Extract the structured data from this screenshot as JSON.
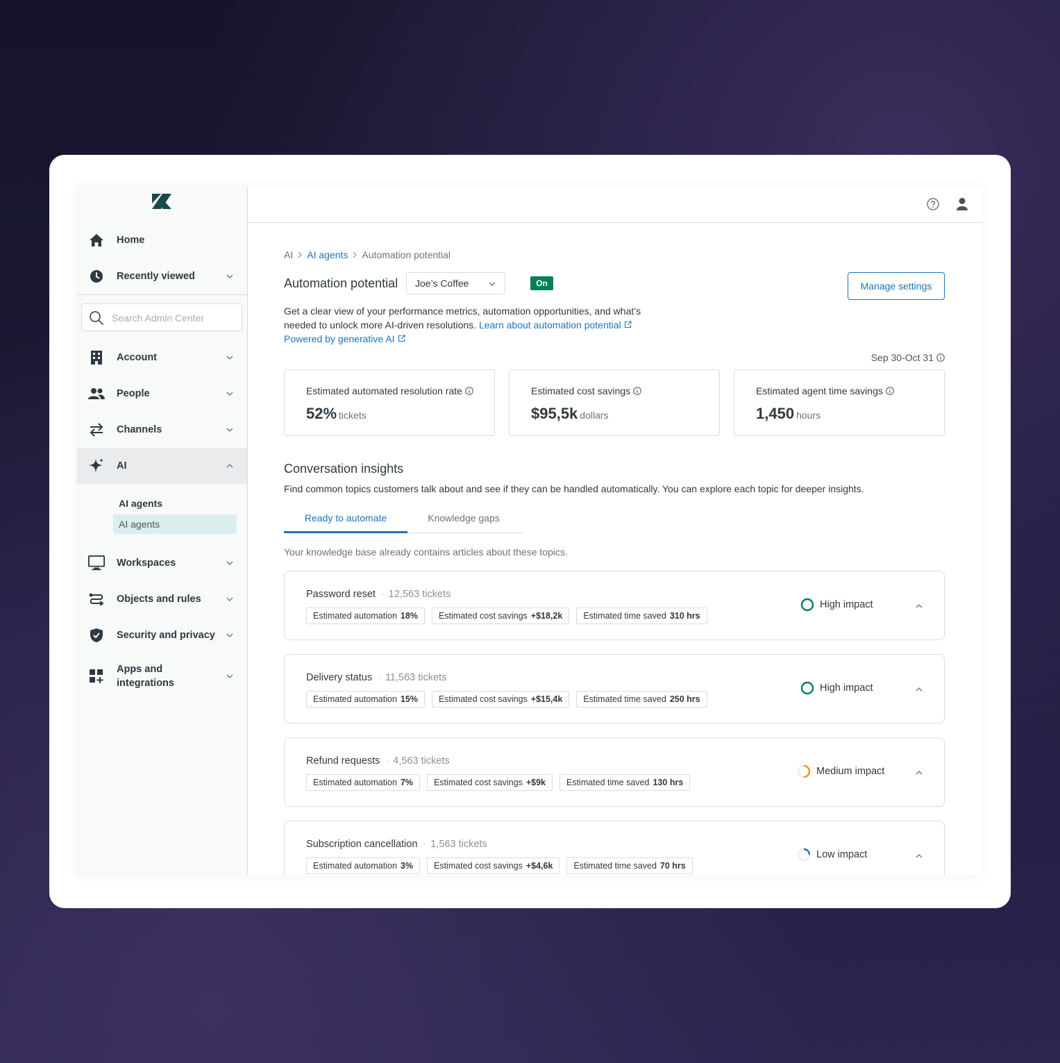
{
  "sidebar": {
    "logo": "zendesk-logo",
    "items": [
      {
        "label": "Home",
        "icon": "home-icon"
      },
      {
        "label": "Recently viewed",
        "icon": "clock-icon"
      },
      {
        "label": "Account",
        "icon": "building-icon"
      },
      {
        "label": "People",
        "icon": "people-icon"
      },
      {
        "label": "Channels",
        "icon": "arrows-icon"
      },
      {
        "label": "AI",
        "icon": "sparkle-icon"
      },
      {
        "label": "Workspaces",
        "icon": "monitor-icon"
      },
      {
        "label": "Objects and rules",
        "icon": "routes-icon"
      },
      {
        "label": "Security and privacy",
        "icon": "shield-icon"
      },
      {
        "label": "Apps and",
        "label2": "integrations",
        "icon": "apps-icon"
      }
    ],
    "search_placeholder": "Search Admin Center",
    "ai_submenu": {
      "heading": "AI agents",
      "selected": "AI agents"
    }
  },
  "header": {
    "help_icon": "help-icon",
    "user_icon": "user-icon"
  },
  "breadcrumb": [
    "AI",
    "AI agents",
    "Automation potential"
  ],
  "page": {
    "title": "Automation potential",
    "brand_select": "Joe’s Coffee",
    "status_badge": "On",
    "manage_button": "Manage settings",
    "description": "Get a clear view of your performance metrics, automation opportunities, and what’s needed to unlock more AI-driven resolutions.",
    "learn_link": "Learn about automation potential",
    "powered_link": "Powered by generative AI",
    "date_range": "Sep 30-Oct 31"
  },
  "metrics": [
    {
      "label": "Estimated automated resolution rate",
      "value": "52%",
      "unit": "tickets"
    },
    {
      "label": "Estimated cost savings",
      "value": "$95,5k",
      "unit": "dollars"
    },
    {
      "label": "Estimated agent time savings",
      "value": "1,450",
      "unit": "hours"
    }
  ],
  "insights": {
    "title": "Conversation insights",
    "description": "Find common topics customers talk about and see if they can be handled automatically. You can explore each topic for deeper insights.",
    "tabs": [
      "Ready to automate",
      "Knowledge gaps"
    ],
    "note": "Your knowledge base already contains articles about these topics.",
    "chip_labels": {
      "automation": "Estimated automation",
      "cost": "Estimated cost savings",
      "time": "Estimated time saved"
    },
    "topics": [
      {
        "name": "Password reset",
        "tickets": "12,563 tickets",
        "automation": "18%",
        "cost": "+$18,2k",
        "time": "310 hrs",
        "impact": "High impact",
        "impact_level": 1.0,
        "impact_color": "#038153"
      },
      {
        "name": "Delivery status",
        "tickets": "11,563 tickets",
        "automation": "15%",
        "cost": "+$15,4k",
        "time": "250 hrs",
        "impact": "High impact",
        "impact_level": 1.0,
        "impact_color": "#038153"
      },
      {
        "name": "Refund requests",
        "tickets": "4,563 tickets",
        "automation": "7%",
        "cost": "+$9k",
        "time": "130 hrs",
        "impact": "Medium impact",
        "impact_level": 0.5,
        "impact_color": "#ed961c"
      },
      {
        "name": "Subscription cancellation",
        "tickets": "1,563 tickets",
        "automation": "3%",
        "cost": "+$4,6k",
        "time": "70 hrs",
        "impact": "Low impact",
        "impact_level": 0.25,
        "impact_color": "#1f73b7"
      }
    ]
  },
  "colors": {
    "accent": "#1f73b7",
    "success": "#038153",
    "warning": "#ed961c",
    "selected_bg": "#dbeeef"
  }
}
